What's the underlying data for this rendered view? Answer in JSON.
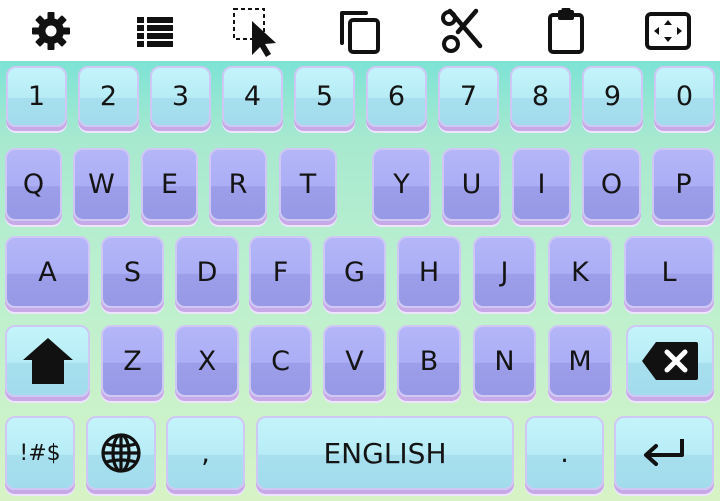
{
  "toolbar": {
    "items": [
      {
        "name": "settings-icon"
      },
      {
        "name": "list-icon"
      },
      {
        "name": "select-icon"
      },
      {
        "name": "copy-icon"
      },
      {
        "name": "cut-icon"
      },
      {
        "name": "paste-icon"
      },
      {
        "name": "fullscreen-icon"
      }
    ]
  },
  "keyboard": {
    "row_numbers": [
      "1",
      "2",
      "3",
      "4",
      "5",
      "6",
      "7",
      "8",
      "9",
      "0"
    ],
    "row_qwerty": [
      "Q",
      "W",
      "E",
      "R",
      "T",
      "Y",
      "U",
      "I",
      "O",
      "P"
    ],
    "row_asdf": [
      "A",
      "S",
      "D",
      "F",
      "G",
      "H",
      "J",
      "K",
      "L"
    ],
    "row_zxcv": [
      "Z",
      "X",
      "C",
      "V",
      "B",
      "N",
      "M"
    ],
    "shift_icon": "shift-icon",
    "backspace_icon": "backspace-icon",
    "symbols_label": "!#$",
    "globe_icon": "globe-icon",
    "comma_label": ",",
    "space_label": "ENGLISH",
    "period_label": ".",
    "enter_icon": "enter-icon"
  },
  "colors": {
    "key_cyan": "#b7ecf6",
    "key_purple": "#acaef6",
    "background_top": "#7de3d5",
    "background_bottom": "#d7f3c6"
  }
}
